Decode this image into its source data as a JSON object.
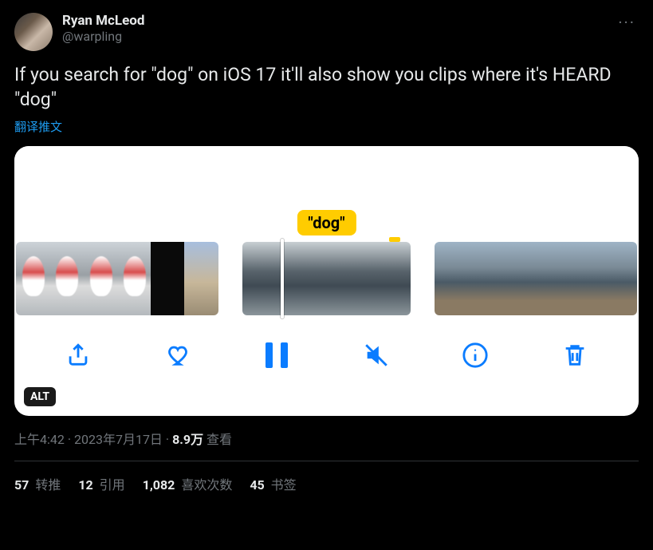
{
  "author": {
    "display_name": "Ryan McLeod",
    "handle": "@warpling"
  },
  "tweet_text": "If you search for \"dog\" on iOS 17 it'll also show you clips where it's HEARD \"dog\"",
  "translate_label": "翻译推文",
  "media": {
    "search_term": "\"dog\"",
    "alt_badge": "ALT"
  },
  "meta": {
    "time": "上午4:42",
    "dot1": " · ",
    "date": "2023年7月17日",
    "dot2": " · ",
    "views_count": "8.9万",
    "views_label": " 查看"
  },
  "stats": {
    "retweets_count": "57",
    "retweets_label": " 转推",
    "quotes_count": "12",
    "quotes_label": " 引用",
    "likes_count": "1,082",
    "likes_label": " 喜欢次数",
    "bookmarks_count": "45",
    "bookmarks_label": " 书签"
  }
}
